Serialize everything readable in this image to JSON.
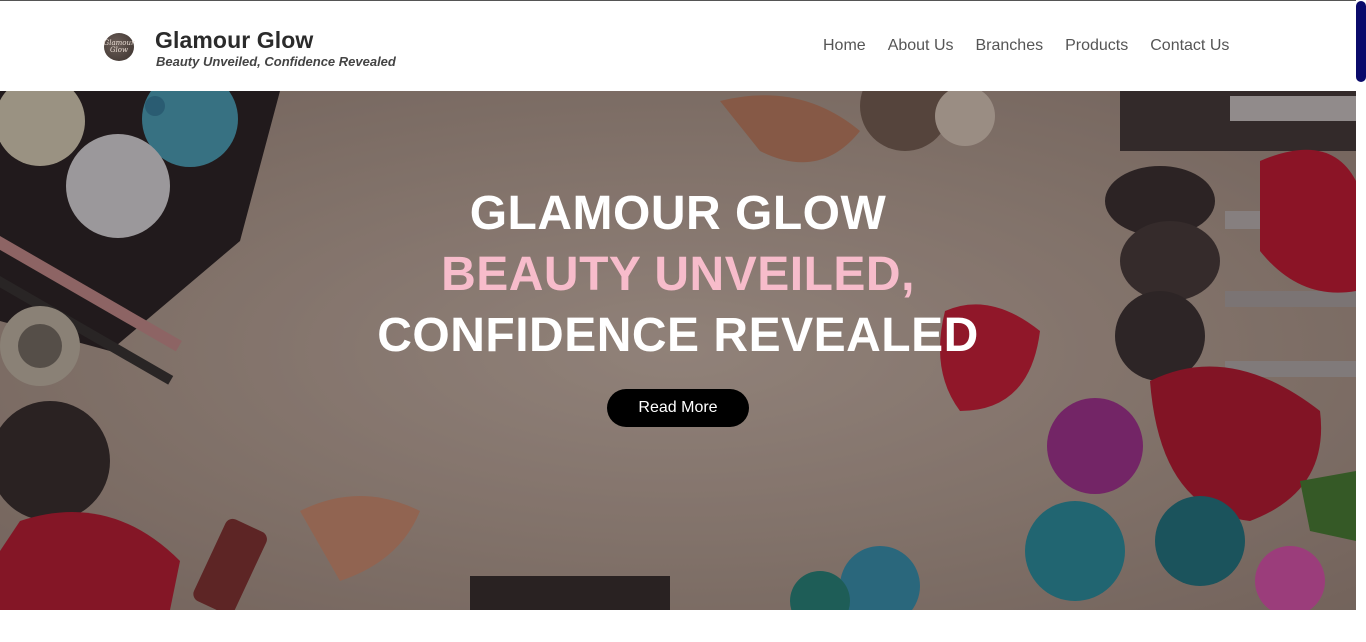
{
  "brand": {
    "title": "Glamour Glow",
    "tagline": "Beauty Unveiled, Confidence Revealed",
    "logo_text": "Glamour Glow"
  },
  "nav": {
    "items": [
      {
        "label": "Home"
      },
      {
        "label": "About Us"
      },
      {
        "label": "Branches"
      },
      {
        "label": "Products"
      },
      {
        "label": "Contact Us"
      }
    ]
  },
  "hero": {
    "line1": "GLAMOUR GLOW",
    "line2": "BEAUTY UNVEILED,",
    "line3": "CONFIDENCE REVEALED",
    "button_label": "Read More",
    "background_icon": "makeup-flatlay-image"
  },
  "colors": {
    "accent_pink": "#f7bccb",
    "button_bg": "#000000",
    "scrollbar": "#0a0a6b"
  }
}
